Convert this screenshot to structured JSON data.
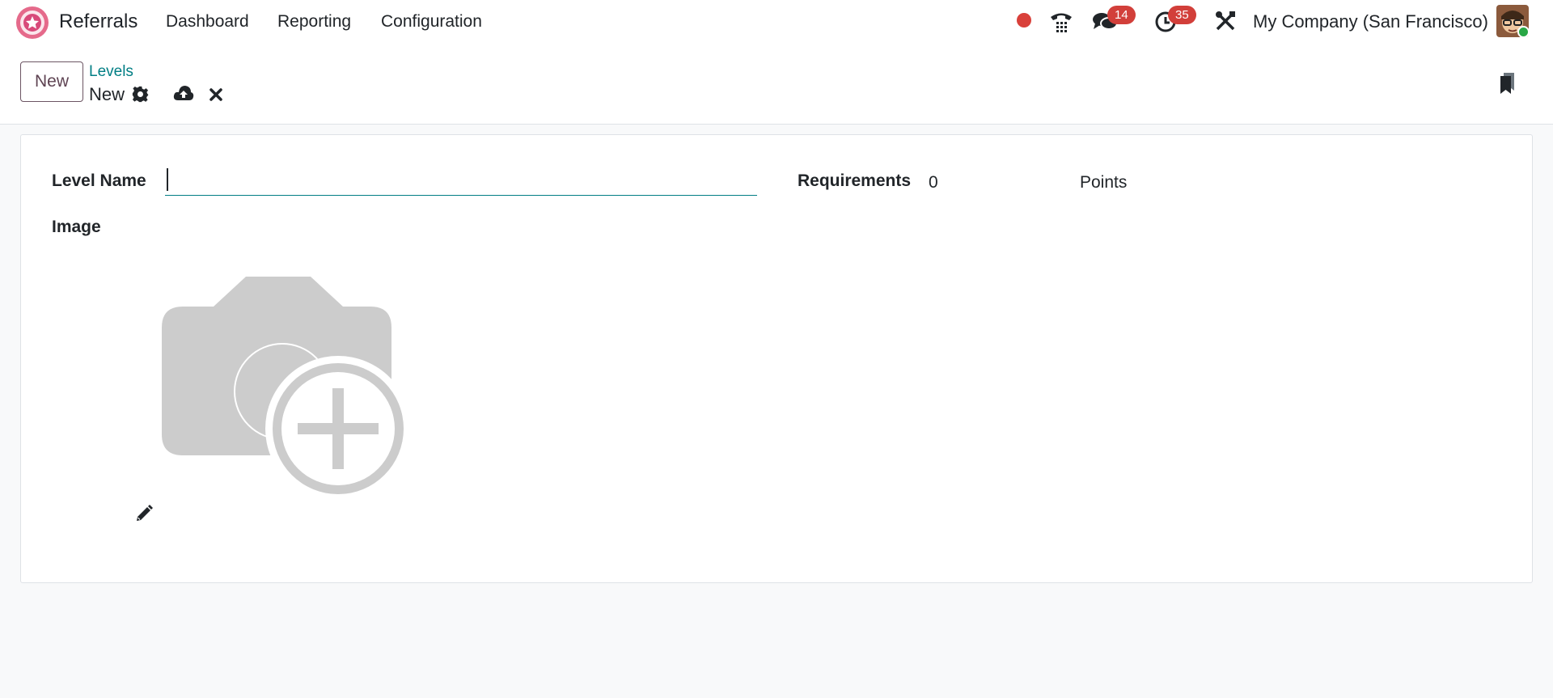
{
  "navbar": {
    "app_name": "Referrals",
    "menu": [
      {
        "label": "Dashboard"
      },
      {
        "label": "Reporting"
      },
      {
        "label": "Configuration"
      }
    ],
    "messages_badge": "14",
    "activities_badge": "35",
    "company": "My Company (San Francisco)",
    "icons": [
      "record-dot-icon",
      "phone-icon",
      "chat-icon",
      "clock-icon",
      "tools-icon"
    ]
  },
  "control_panel": {
    "new_button": "New",
    "breadcrumb": "Levels",
    "record_name": "New",
    "icons": [
      "gear-icon",
      "cloud-upload-icon",
      "close-icon",
      "bookmark-icon"
    ]
  },
  "form": {
    "level_name_label": "Level Name",
    "level_name_value": "",
    "requirements_label": "Requirements",
    "requirements_value": "0",
    "requirements_unit": "Points",
    "image_label": "Image"
  },
  "colors": {
    "accent": "#017e84",
    "brand": "#714b67",
    "badge": "#d23f3a",
    "status_dot": "#d9403a"
  }
}
